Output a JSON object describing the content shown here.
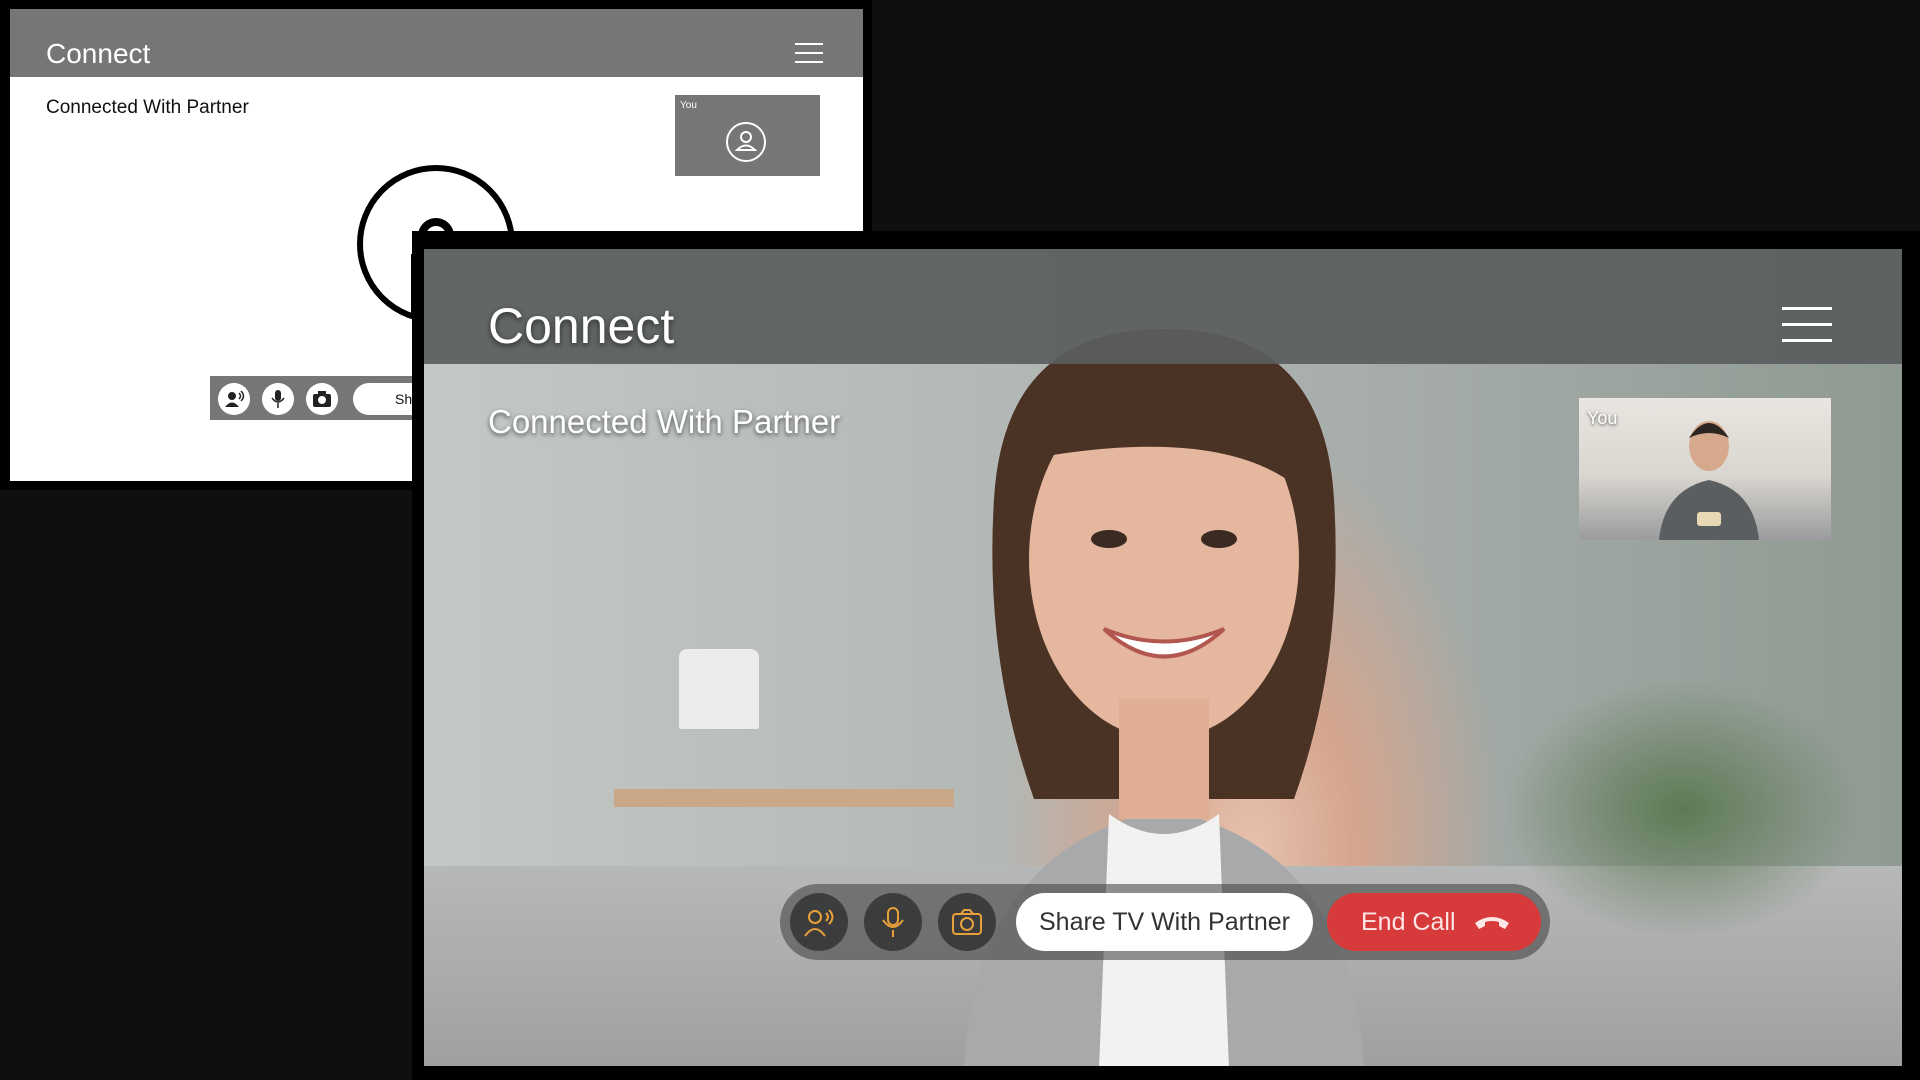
{
  "wireframe": {
    "app_title": "Connect",
    "status": "Connected With Partner",
    "self_view_label": "You",
    "share_label_partial": "Sh",
    "controls": [
      "voice-call-icon",
      "microphone-icon",
      "camera-icon"
    ]
  },
  "hifi": {
    "app_title": "Connect",
    "status": "Connected With Partner",
    "self_view_label": "You",
    "share_button_label": "Share TV With Partner",
    "end_call_label": "End Call",
    "controls": [
      "voice-call-icon",
      "microphone-icon",
      "camera-icon",
      "hang-up-icon"
    ]
  },
  "colors": {
    "background": "#0f0f0f",
    "wireframe_gray": "#767676",
    "accent_orange": "#e8a13a",
    "end_call_red": "#d63a3a"
  }
}
